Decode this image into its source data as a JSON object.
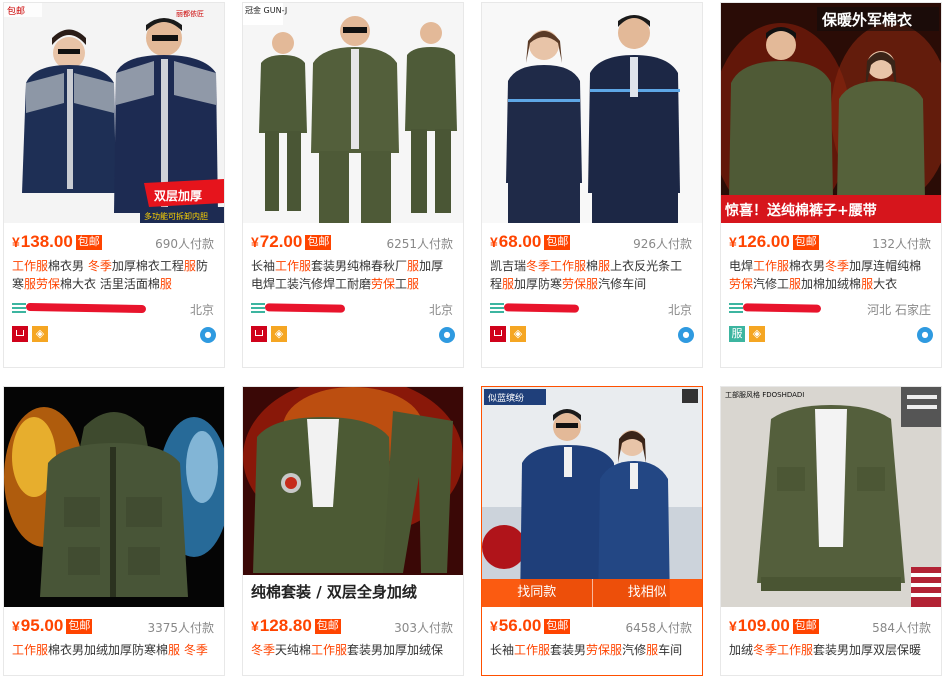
{
  "currency_symbol": "¥",
  "colors": {
    "accent": "#ff4400",
    "tmall_red": "#d0021b",
    "wangwang_blue": "#2f9ae0"
  },
  "products": [
    {
      "price": "138.00",
      "free_shipping": "包邮",
      "sales": "690人付款",
      "title_parts": [
        {
          "t": "工作服",
          "hl": true
        },
        {
          "t": "棉衣男 ",
          "hl": false
        },
        {
          "t": "冬季",
          "hl": true
        },
        {
          "t": "加厚棉衣工程",
          "hl": false
        },
        {
          "t": "服",
          "hl": true
        },
        {
          "t": "防寒",
          "hl": false
        },
        {
          "t": "服",
          "hl": true
        },
        {
          "t": "劳保",
          "hl": true
        },
        {
          "t": "棉大衣 活里活面棉",
          "hl": false
        },
        {
          "t": "服",
          "hl": true
        }
      ],
      "location": "北京",
      "badges": [
        "tmall-icon",
        "gold-seller-icon"
      ],
      "image": {
        "brand": "丽都依匠",
        "promo1": "双层加厚",
        "promo2": "多功能可拆卸内胆"
      }
    },
    {
      "price": "72.00",
      "free_shipping": "包邮",
      "sales": "6251人付款",
      "title_parts": [
        {
          "t": "长袖",
          "hl": false
        },
        {
          "t": "工作服",
          "hl": true
        },
        {
          "t": "套装男纯棉春秋厂",
          "hl": false
        },
        {
          "t": "服",
          "hl": true
        },
        {
          "t": "加厚电焊工装汽修焊工耐磨",
          "hl": false
        },
        {
          "t": "劳保",
          "hl": true
        },
        {
          "t": "工",
          "hl": false
        },
        {
          "t": "服",
          "hl": true
        }
      ],
      "location": "北京",
      "badges": [
        "tmall-icon",
        "gold-seller-icon"
      ],
      "image": {
        "brand": "冠金 GUN-J"
      }
    },
    {
      "price": "68.00",
      "free_shipping": "包邮",
      "sales": "926人付款",
      "title_parts": [
        {
          "t": "凯吉瑞",
          "hl": false
        },
        {
          "t": "冬季",
          "hl": true
        },
        {
          "t": "工作服",
          "hl": true
        },
        {
          "t": "棉",
          "hl": false
        },
        {
          "t": "服",
          "hl": true
        },
        {
          "t": "上衣反光条工程",
          "hl": false
        },
        {
          "t": "服",
          "hl": true
        },
        {
          "t": "加厚防寒",
          "hl": false
        },
        {
          "t": "劳保服",
          "hl": true
        },
        {
          "t": "汽修车间",
          "hl": false
        }
      ],
      "location": "北京",
      "badges": [
        "tmall-icon",
        "gold-seller-icon"
      ],
      "image": {}
    },
    {
      "price": "126.00",
      "free_shipping": "包邮",
      "sales": "132人付款",
      "title_parts": [
        {
          "t": "电焊",
          "hl": false
        },
        {
          "t": "工作服",
          "hl": true
        },
        {
          "t": "棉衣男",
          "hl": false
        },
        {
          "t": "冬季",
          "hl": true
        },
        {
          "t": "加厚连帽纯棉",
          "hl": false
        },
        {
          "t": "劳保",
          "hl": true
        },
        {
          "t": "汽修工",
          "hl": false
        },
        {
          "t": "服",
          "hl": true
        },
        {
          "t": "加棉加绒棉",
          "hl": false
        },
        {
          "t": "服",
          "hl": true
        },
        {
          "t": "大衣",
          "hl": false
        }
      ],
      "location": "河北 石家庄",
      "badges": [
        "service-icon",
        "gold-seller-icon"
      ],
      "image": {
        "top_banner": "保暖外军棉衣",
        "bottom_banner": "惊喜！送纯棉裤子+腰带"
      }
    },
    {
      "price": "95.00",
      "free_shipping": "包邮",
      "sales": "3375人付款",
      "title_parts": [
        {
          "t": "工作服",
          "hl": true
        },
        {
          "t": "棉衣男加绒加厚防寒棉",
          "hl": false
        },
        {
          "t": "服",
          "hl": true
        },
        {
          "t": " 冬季",
          "hl": true
        }
      ],
      "image": {}
    },
    {
      "price": "128.80",
      "free_shipping": "包邮",
      "sales": "303人付款",
      "title_parts": [
        {
          "t": "冬季",
          "hl": true
        },
        {
          "t": "天纯棉",
          "hl": false
        },
        {
          "t": "工作服",
          "hl": true
        },
        {
          "t": "套装男加厚加绒保",
          "hl": false
        }
      ],
      "image": {
        "banner": "纯棉套装 / 双层全身加绒"
      }
    },
    {
      "price": "56.00",
      "free_shipping": "包邮",
      "sales": "6458人付款",
      "title_parts": [
        {
          "t": "长袖",
          "hl": false
        },
        {
          "t": "工作服",
          "hl": true
        },
        {
          "t": "套装男",
          "hl": false
        },
        {
          "t": "劳保服",
          "hl": true
        },
        {
          "t": "汽修",
          "hl": false
        },
        {
          "t": "服",
          "hl": true
        },
        {
          "t": "车间",
          "hl": false
        }
      ],
      "image": {
        "brand": "似蓝缤纷"
      },
      "hover_actions": [
        "找同款",
        "找相似"
      ]
    },
    {
      "price": "109.00",
      "free_shipping": "包邮",
      "sales": "584人付款",
      "title_parts": [
        {
          "t": "加绒",
          "hl": false
        },
        {
          "t": "冬季",
          "hl": true
        },
        {
          "t": "工作服",
          "hl": true
        },
        {
          "t": "套装男加厚双层保暖",
          "hl": false
        }
      ],
      "image": {
        "brand": "工部服风格 FDOSHDADI"
      }
    }
  ]
}
